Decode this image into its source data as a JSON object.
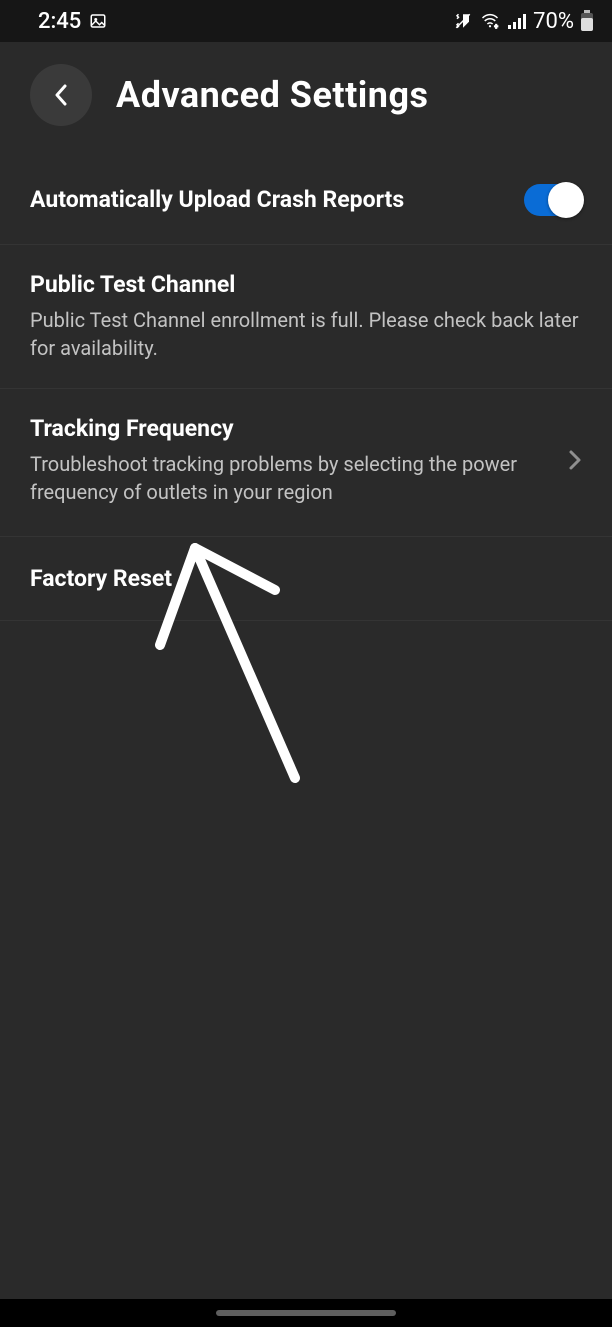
{
  "statusbar": {
    "time": "2:45",
    "battery": "70%"
  },
  "header": {
    "title": "Advanced Settings"
  },
  "settings": {
    "crash_reports": {
      "title": "Automatically Upload Crash Reports",
      "enabled": true
    },
    "ptc": {
      "title": "Public Test Channel",
      "subtitle": "Public Test Channel enrollment is full. Please check back later for availability."
    },
    "tracking_freq": {
      "title": "Tracking Frequency",
      "subtitle": "Troubleshoot tracking problems by selecting the power frequency of outlets in your region"
    },
    "factory_reset": {
      "title": "Factory Reset"
    }
  }
}
